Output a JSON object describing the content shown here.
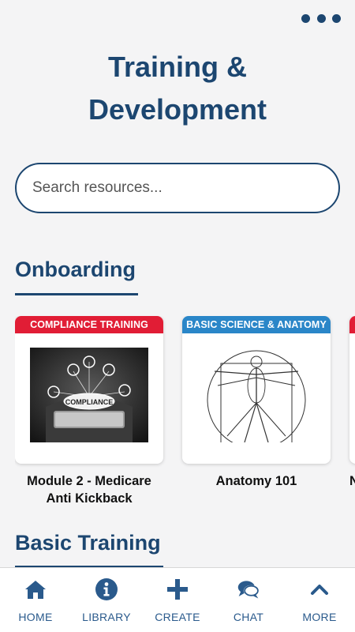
{
  "header": {
    "more_menu_icon": "more-horizontal-icon",
    "title_line1": "Training &",
    "title_line2": "Development"
  },
  "search": {
    "placeholder": "Search resources...",
    "value": ""
  },
  "sections": [
    {
      "title": "Onboarding",
      "cards": [
        {
          "tag": "COMPLIANCE TRAINING",
          "tag_color": "#e11d35",
          "title": "Module 2 - Medicare Anti Kickback",
          "image_text": "COMPLIANCE"
        },
        {
          "tag": "BASIC SCIENCE & ANATOMY",
          "tag_color": "#2a86c8",
          "title": "Anatomy 101"
        },
        {
          "tag": "",
          "tag_color": "#e11d35",
          "title": "N"
        }
      ]
    },
    {
      "title": "Basic Training"
    }
  ],
  "tabbar": {
    "items": [
      {
        "label": "HOME",
        "icon": "home-icon"
      },
      {
        "label": "LIBRARY",
        "icon": "info-icon"
      },
      {
        "label": "CREATE",
        "icon": "plus-icon"
      },
      {
        "label": "CHAT",
        "icon": "chat-icon"
      },
      {
        "label": "MORE",
        "icon": "chevron-up-icon"
      }
    ]
  },
  "colors": {
    "primary": "#1c4670",
    "background": "#f4f4f5",
    "compliance_tag": "#e11d35",
    "science_tag": "#2a86c8"
  }
}
